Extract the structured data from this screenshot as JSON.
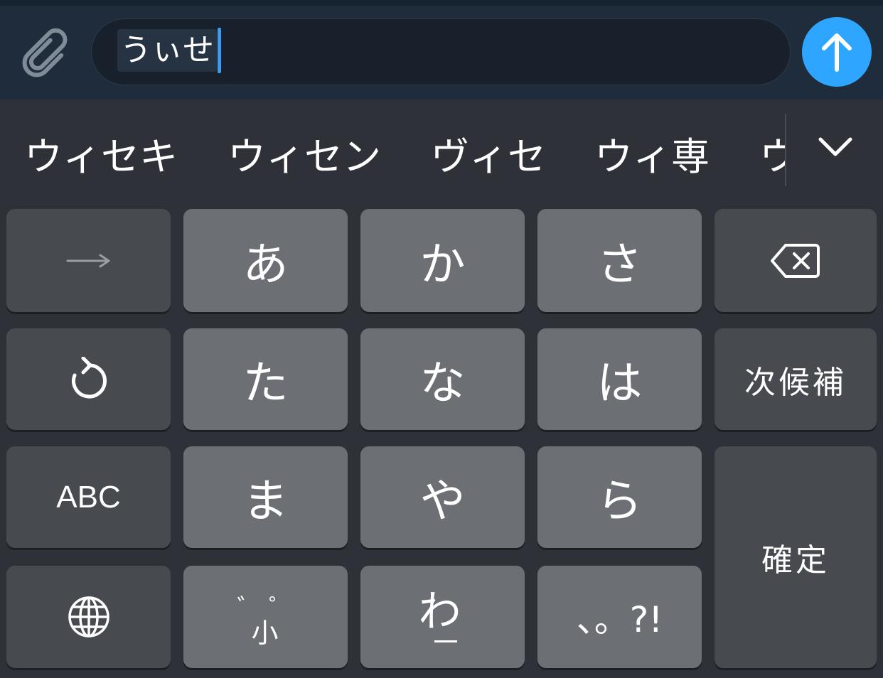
{
  "input": {
    "composing_text": "うぃせ"
  },
  "candidates": [
    "ウィセキ",
    "ウィセン",
    "ヴィセ",
    "ウィ専",
    "ウ"
  ],
  "icons": {
    "attach": "paperclip-icon",
    "send": "arrow-up-icon",
    "expand": "chevron-down-icon",
    "right": "arrow-right-icon",
    "delete": "backspace-icon",
    "undo": "undo-icon",
    "globe": "globe-icon"
  },
  "keyboard": {
    "a": "あ",
    "ka": "か",
    "sa": "さ",
    "ta": "た",
    "na": "な",
    "ha": "は",
    "next_candidate": "次候補",
    "abc": "ABC",
    "ma": "ま",
    "ya": "や",
    "ra": "ら",
    "confirm": "確定",
    "dakuten": "゛ ゜",
    "dakuten_small": "小",
    "wa": "わ",
    "punct": "、。?!"
  },
  "colors": {
    "accent": "#2ea6ff",
    "caret": "#3d9cf0",
    "input_bar": "#1f2c3b",
    "keyboard_bg": "#2e3138",
    "key_light": "#6c7075",
    "key_dark": "#474b50"
  }
}
